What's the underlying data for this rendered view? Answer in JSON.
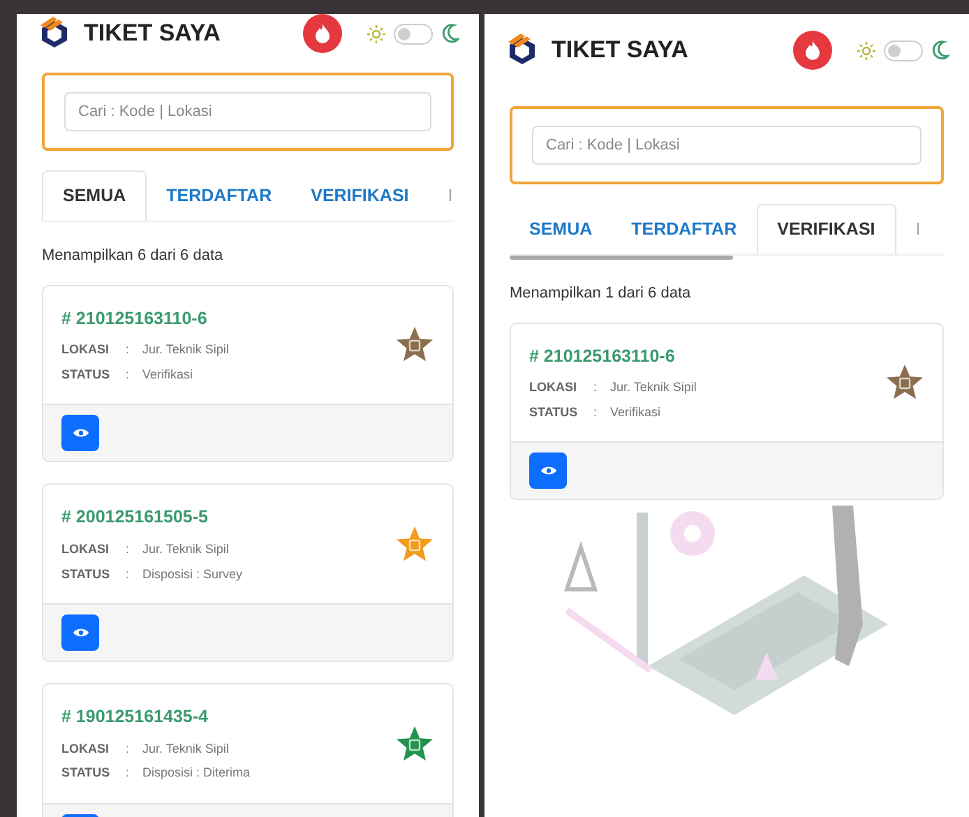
{
  "panels": [
    {
      "header": {
        "title": "TIKET SAYA",
        "theme_toggle": {
          "on": false
        }
      },
      "search": {
        "placeholder": "Cari : Kode | Lokasi"
      },
      "tabs": [
        {
          "label": "SEMUA",
          "selected": true
        },
        {
          "label": "TERDAFTAR",
          "selected": false
        },
        {
          "label": "VERIFIKASI",
          "selected": false
        },
        {
          "label": "I",
          "selected": false
        }
      ],
      "summary": "Menampilkan 6 dari 6 data",
      "tickets": [
        {
          "code": "# 210125163110-6",
          "color": "#8b6e4e",
          "fields": [
            {
              "label": "LOKASI",
              "colon": ":",
              "value": "Jur. Teknik Sipil"
            },
            {
              "label": "STATUS",
              "colon": ":",
              "value": "Verifikasi"
            }
          ]
        },
        {
          "code": "# 200125161505-5",
          "color": "#f29b1d",
          "fields": [
            {
              "label": "LOKASI",
              "colon": ":",
              "value": "Jur. Teknik Sipil"
            },
            {
              "label": "STATUS",
              "colon": ":",
              "value": "Disposisi : Survey"
            }
          ]
        },
        {
          "code": "# 190125161435-4",
          "color": "#22934f",
          "fields": [
            {
              "label": "LOKASI",
              "colon": ":",
              "value": "Jur. Teknik Sipil"
            },
            {
              "label": "STATUS",
              "colon": ":",
              "value": "Disposisi : Diterima"
            }
          ]
        }
      ]
    },
    {
      "header": {
        "title": "TIKET SAYA",
        "theme_toggle": {
          "on": false
        }
      },
      "search": {
        "placeholder": "Cari : Kode | Lokasi"
      },
      "tabs": [
        {
          "label": "SEMUA",
          "selected": false
        },
        {
          "label": "TERDAFTAR",
          "selected": false
        },
        {
          "label": "VERIFIKASI",
          "selected": true
        },
        {
          "label": "I",
          "selected": false
        }
      ],
      "summary": "Menampilkan 1 dari 6 data",
      "tickets": [
        {
          "code": "# 210125163110-6",
          "color": "#8b6e4e",
          "fields": [
            {
              "label": "LOKASI",
              "colon": ":",
              "value": "Jur. Teknik Sipil"
            },
            {
              "label": "STATUS",
              "colon": ":",
              "value": "Verifikasi"
            }
          ]
        }
      ]
    }
  ]
}
